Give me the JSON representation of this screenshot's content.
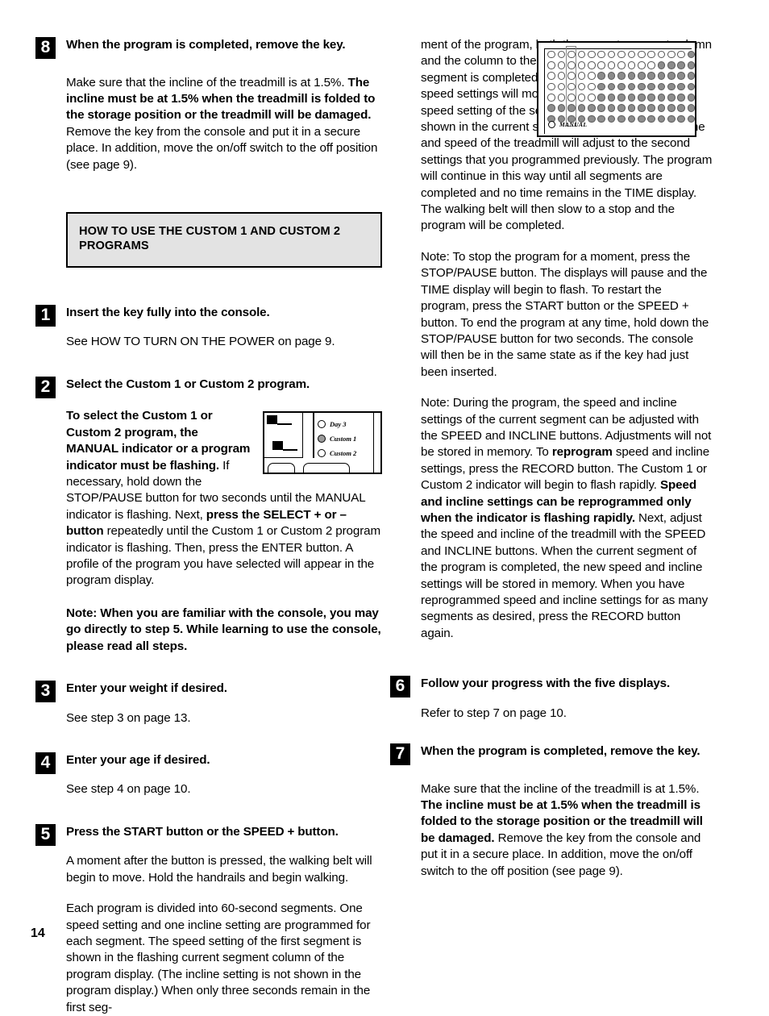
{
  "page": {
    "number": "14"
  },
  "left_column": {
    "step8": {
      "number": "8",
      "title": "When the program is completed, remove the key.",
      "body_lead": "Make sure that the incline of the treadmill is at 1.5%. ",
      "body_bold": "The incline must be at 1.5% when the treadmill is folded to the storage position or the treadmill will be damaged.",
      "body_tail": " Remove the key from the console and put it in a secure place. In addition, move the on/off switch to the off position (see page 9)."
    },
    "section_heading": "HOW TO USE THE CUSTOM 1 AND CUSTOM 2 PROGRAMS",
    "step1": {
      "number": "1",
      "title": "Insert the key fully into the console.",
      "body": "See HOW TO TURN ON THE POWER on page 9."
    },
    "step2": {
      "number": "2",
      "title": "Select the Custom 1 or Custom 2  program.",
      "body_bold_1": "To select the Custom 1 or Custom 2 program, the MANUAL indicator or a program indicator must be flashing.",
      "body_tail_1": " If necessary, hold down the STOP/PAUSE button for two seconds until the MANUAL indicator is flashing. Next, ",
      "body_bold_2": "press the SELECT + or – button",
      "body_tail_2": " repeatedly until the Custom 1 or Custom 2 program indicator is flashing. Then, press the ENTER button. A profile of the program you have selected will appear in the program display.",
      "note_bold": "Note: When you are familiar with the console, you may go directly to step 5. While learning to use the console, please read all steps."
    },
    "step3": {
      "number": "3",
      "title": "Enter your weight if desired.",
      "body": "See step 3 on page 13."
    },
    "step4": {
      "number": "4",
      "title": "Enter your age if desired.",
      "body": "See step 4 on page 10."
    },
    "step5": {
      "number": "5",
      "title": "Press the START button or the SPEED + button.",
      "body_1": "A moment after the button is pressed, the walking belt will begin to move. Hold the handrails and begin walking.",
      "body_2": "Each program is divided into 60-second segments. One speed setting and one incline setting are programmed for each segment. The speed setting of the first segment is shown in the flashing current segment column of the program display. (The incline setting is not shown in the program display.) When only three seconds remain in the first seg-"
    }
  },
  "right_column": {
    "continuation": "ment of the program, both the current segment column and the column to the right will flash. When the first segment is completed, two tones will sound and all speed settings will move one column to the left. The speed setting of the second segment will then be shown in the current segment column, and the incline and speed of the treadmill will adjust to the second settings that you programmed previously. The program will continue in this way until all segments are completed and no time remains in the TIME display. The walking belt will then slow to a stop and the program will be completed.",
    "note_1": "Note: To stop the program for a moment, press the STOP/PAUSE button. The displays will pause and the TIME display will begin to flash. To restart the program, press the START button or the SPEED + button. To end the program at any time, hold down the STOP/PAUSE button for two seconds. The console will then be in the same state as if the key had just been inserted.",
    "note_2_lead": "Note: During the program, the speed and incline settings of the current segment can be adjusted with the SPEED and INCLINE buttons. Adjustments will not be stored in memory. To ",
    "note_2_bold_1": "reprogram",
    "note_2_mid": " speed and incline settings, press the RECORD button. The Custom 1 or Custom 2 indicator will begin to flash rapidly. ",
    "note_2_bold_2": "Speed and incline settings can be reprogrammed only when the indicator is flashing rapidly.",
    "note_2_tail": " Next, adjust the speed and incline of the treadmill with the SPEED and INCLINE buttons. When the current segment of the program is completed, the new speed and incline settings will be stored in memory. When you have reprogrammed speed and incline settings for as many segments as desired, press the RECORD button again.",
    "step6": {
      "number": "6",
      "title": "Follow your progress with the five displays.",
      "body": "Refer to step 7 on page 10."
    },
    "step7": {
      "number": "7",
      "title": "When the program is completed, remove the key.",
      "body_lead": "Make sure that the incline of the treadmill is at 1.5%. ",
      "body_bold": "The incline must be at 1.5% when the treadmill is folded to the storage position or the treadmill will be damaged.",
      "body_tail": " Remove the key from the console and put it in a secure place. In addition, move the on/off switch to the off position (see page 9)."
    }
  },
  "figures": {
    "console_panel": {
      "indicators": [
        {
          "label": "Day 3",
          "lit": false
        },
        {
          "label": "Custom 1",
          "lit": true
        },
        {
          "label": "Custom 2",
          "lit": false
        }
      ]
    },
    "program_display": {
      "manual_label": "MANUAL",
      "manual_lit": false,
      "rows": 7,
      "columns": 15,
      "highlight_column": 3,
      "matrix": [
        [
          0,
          0,
          0,
          0,
          0,
          0,
          0,
          0,
          0,
          0,
          0,
          0,
          0,
          0,
          1
        ],
        [
          0,
          0,
          0,
          0,
          0,
          0,
          0,
          0,
          0,
          0,
          0,
          1,
          1,
          1,
          1
        ],
        [
          0,
          0,
          0,
          0,
          0,
          1,
          1,
          1,
          1,
          1,
          1,
          1,
          1,
          1,
          1
        ],
        [
          0,
          0,
          0,
          0,
          0,
          1,
          1,
          1,
          1,
          1,
          1,
          1,
          1,
          1,
          1
        ],
        [
          0,
          0,
          0,
          0,
          0,
          1,
          1,
          1,
          1,
          1,
          1,
          1,
          1,
          1,
          1
        ],
        [
          1,
          1,
          1,
          1,
          1,
          1,
          1,
          1,
          1,
          1,
          1,
          1,
          1,
          1,
          1
        ],
        [
          1,
          1,
          1,
          1,
          1,
          1,
          1,
          1,
          1,
          1,
          1,
          1,
          1,
          1,
          1
        ]
      ]
    }
  },
  "colors": {
    "section_box_bg": "#e3e3e3",
    "ink": "#000000",
    "dot_on": "#8c8c8c",
    "paper": "#ffffff"
  }
}
